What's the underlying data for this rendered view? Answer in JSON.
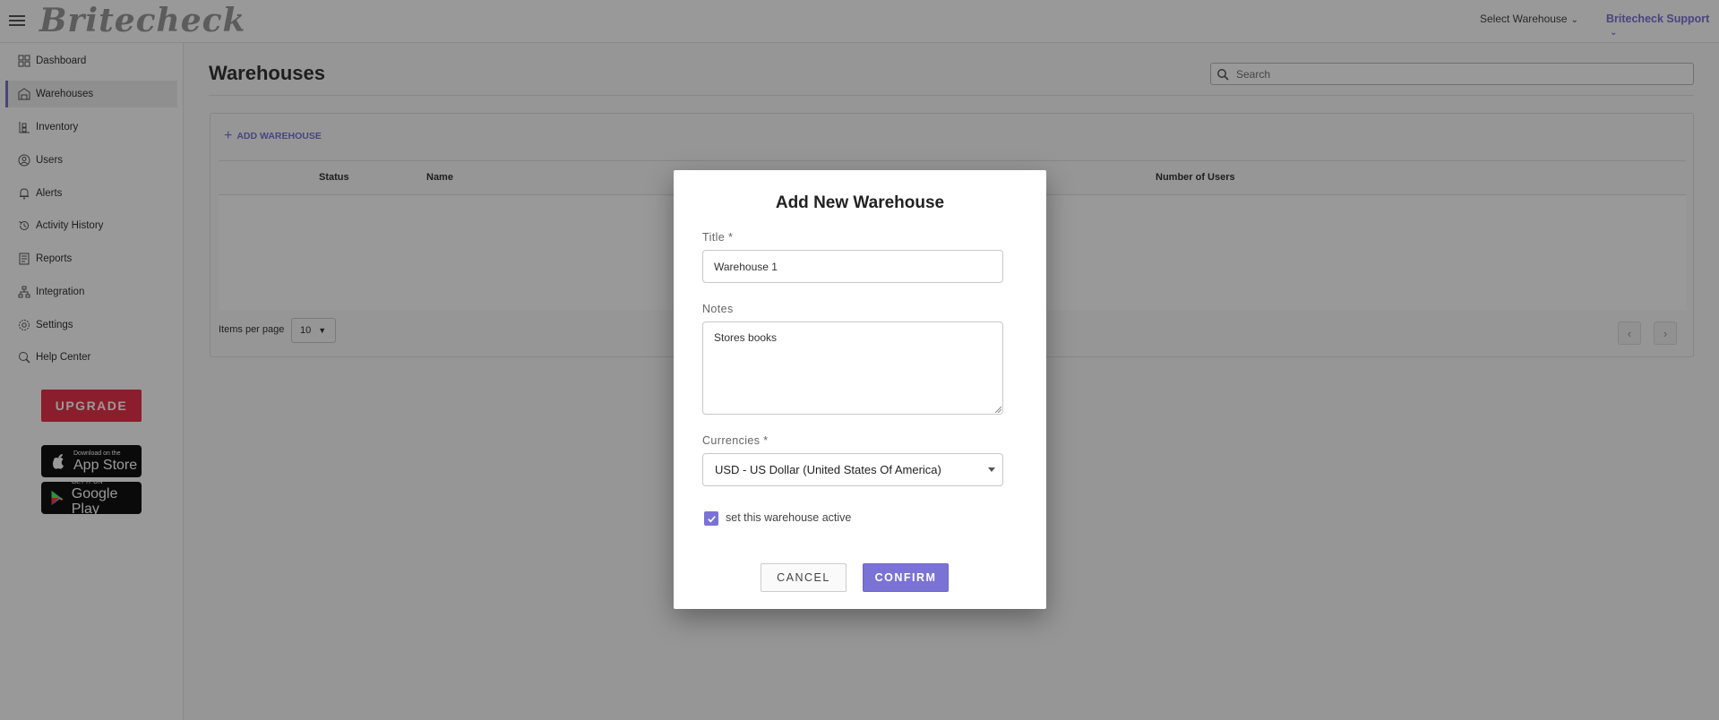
{
  "header": {
    "logo_text": "Britecheck",
    "warehouse_selector": "Select Warehouse",
    "user_menu": "Britecheck Support"
  },
  "sidebar": {
    "items": [
      {
        "label": "Dashboard",
        "icon": "dashboard-icon"
      },
      {
        "label": "Warehouses",
        "icon": "warehouse-icon",
        "active": true
      },
      {
        "label": "Inventory",
        "icon": "inventory-icon"
      },
      {
        "label": "Users",
        "icon": "users-icon"
      },
      {
        "label": "Alerts",
        "icon": "bell-icon"
      },
      {
        "label": "Activity History",
        "icon": "history-icon"
      },
      {
        "label": "Reports",
        "icon": "reports-icon"
      },
      {
        "label": "Integration",
        "icon": "integration-icon"
      },
      {
        "label": "Settings",
        "icon": "gear-icon"
      },
      {
        "label": "Help Center",
        "icon": "help-icon"
      }
    ],
    "upgrade_label": "UPGRADE",
    "app_store": {
      "small": "Download on the",
      "big": "App Store"
    },
    "google_play": {
      "small": "GET IT ON",
      "big": "Google Play"
    }
  },
  "main": {
    "title": "Warehouses",
    "search_placeholder": "Search",
    "add_warehouse_label": "ADD WAREHOUSE",
    "columns": [
      "Status",
      "Name",
      "Number of Users"
    ],
    "items_per_page_label": "Items per page",
    "items_per_page_value": "10"
  },
  "modal": {
    "title": "Add New Warehouse",
    "title_label": "Title *",
    "title_value": "Warehouse 1",
    "notes_label": "Notes",
    "notes_value": "Stores books",
    "currencies_label": "Currencies *",
    "currency_value": "USD - US Dollar (United States Of America)",
    "active_label": "set this warehouse active",
    "active_checked": true,
    "cancel_label": "CANCEL",
    "confirm_label": "CONFIRM"
  },
  "colors": {
    "accent": "#7b72d6",
    "upgrade": "#e8334a"
  }
}
